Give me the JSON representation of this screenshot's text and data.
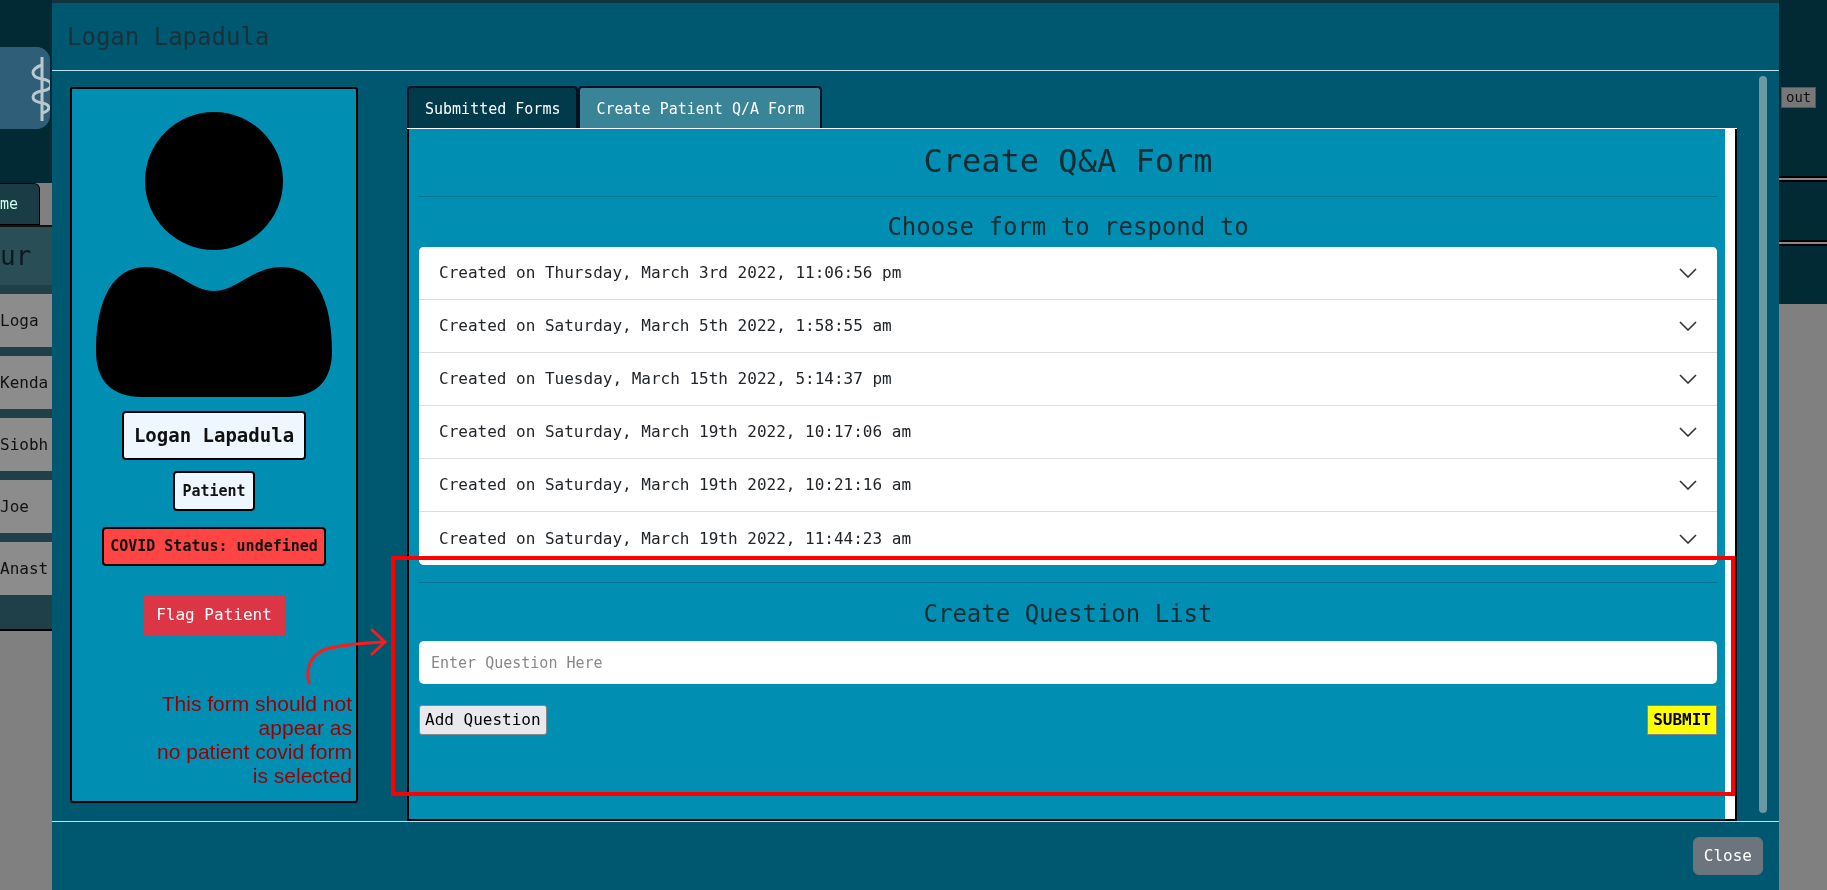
{
  "background": {
    "tab_label": "me",
    "heading": "ur",
    "rows": [
      "Loga",
      "Kenda",
      "Siobh",
      "Joe",
      "Anast"
    ],
    "button": "out"
  },
  "modal": {
    "title": "Logan Lapadula",
    "profile": {
      "name": "Logan Lapadula",
      "role": "Patient",
      "covid_status": "COVID Status: undefined",
      "flag_button": "Flag Patient"
    },
    "tabs": [
      {
        "label": "Submitted Forms",
        "selected": false
      },
      {
        "label": "Create Patient Q/A Form",
        "selected": true
      }
    ],
    "form": {
      "title": "Create Q&A Form",
      "subtitle": "Choose form to respond to",
      "forms": [
        {
          "label": "Created on Thursday, March 3rd 2022, 11:06:56 pm",
          "expanded": false
        },
        {
          "label": "Created on Saturday, March 5th 2022, 1:58:55 am",
          "expanded": false
        },
        {
          "label": "Created on Tuesday, March 15th 2022, 5:14:37 pm",
          "expanded": false
        },
        {
          "label": "Created on Saturday, March 19th 2022, 10:17:06 am",
          "expanded": false
        },
        {
          "label": "Created on Saturday, March 19th 2022, 10:21:16 am",
          "expanded": false
        },
        {
          "label": "Created on Saturday, March 19th 2022, 11:44:23 am",
          "expanded": false
        }
      ],
      "question_heading": "Create Question List",
      "question_field": {
        "placeholder": "Enter Question Here"
      },
      "add_button": "Add Question",
      "submit_button": "SUBMIT"
    },
    "close_button": "Close"
  },
  "annotation": {
    "text": "This form should not\nappear as\nno patient covid form\nis selected"
  }
}
